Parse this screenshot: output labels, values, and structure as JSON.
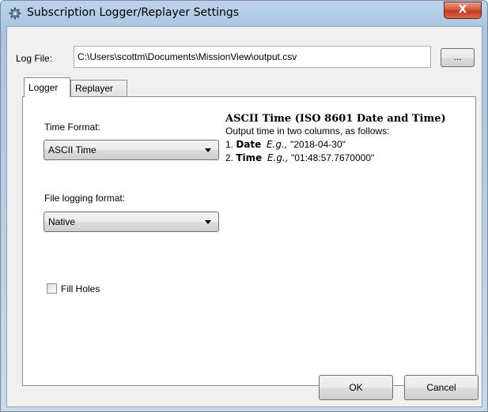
{
  "window": {
    "title": "Subscription Logger/Replayer Settings",
    "close_label": "X"
  },
  "log_file": {
    "label": "Log File:",
    "value": "C:\\Users\\scottm\\Documents\\MissionView\\output.csv",
    "browse_label": "..."
  },
  "tabs": [
    {
      "label": "Logger",
      "active": true
    },
    {
      "label": "Replayer",
      "active": false
    }
  ],
  "logger": {
    "time_format_label": "Time Format:",
    "time_format_value": "ASCII Time",
    "file_logging_label": "File logging format:",
    "file_logging_value": "Native",
    "fill_holes_label": "Fill Holes",
    "fill_holes_checked": false
  },
  "info": {
    "title": "ASCII Time (ISO 8601 Date and Time)",
    "description": "Output time in two columns, as follows:",
    "items": [
      {
        "num": "1.",
        "name": "Date",
        "eg": "E.g.,",
        "example": "\"2018-04-30\""
      },
      {
        "num": "2.",
        "name": "Time",
        "eg": "E.g.,",
        "example": "\"01:48:57.7670000\""
      }
    ]
  },
  "buttons": {
    "ok": "OK",
    "cancel": "Cancel"
  }
}
